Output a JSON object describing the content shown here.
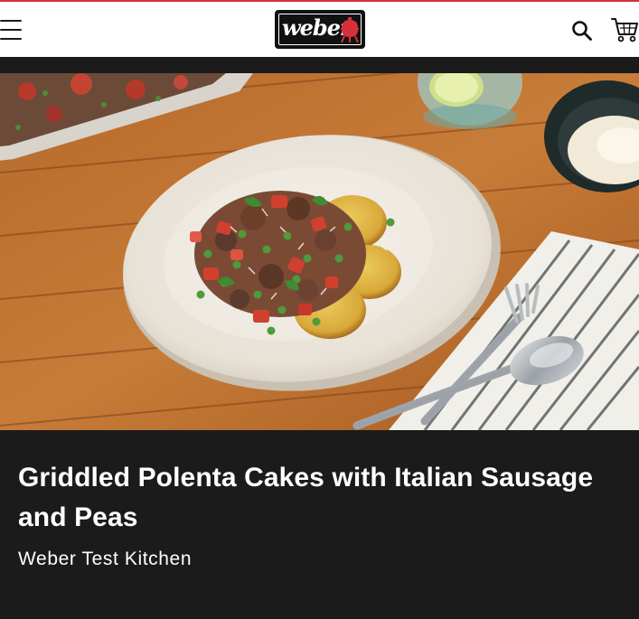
{
  "header": {
    "logo_text": "weber",
    "menu_icon": "hamburger-menu-icon",
    "search_icon": "search-icon",
    "cart_icon": "shopping-cart-icon",
    "accent_color": "#d6303a"
  },
  "recipe": {
    "title": "Griddled Polenta Cakes with Italian Sausage and Peas",
    "author": "Weber Test Kitchen"
  },
  "colors": {
    "page_background": "#1b1b1b",
    "header_background": "#ffffff",
    "text": "#ffffff"
  }
}
